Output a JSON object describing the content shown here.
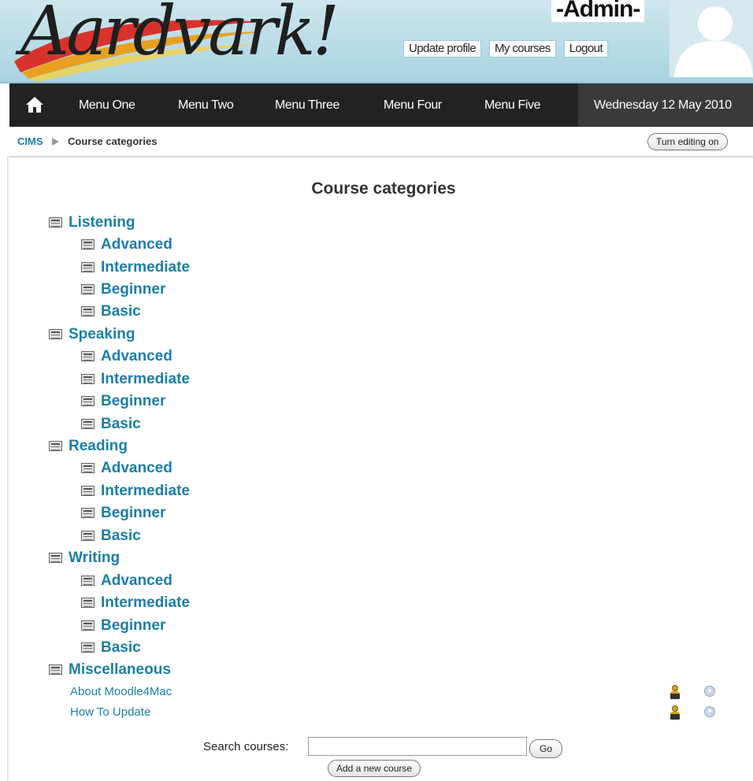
{
  "header": {
    "logo_text": "Aardvark!",
    "admin_label": "-Admin-",
    "links": [
      "Update profile",
      "My courses",
      "Logout"
    ]
  },
  "nav": {
    "home_icon": "home-icon",
    "items": [
      "Menu One",
      "Menu Two",
      "Menu Three",
      "Menu Four",
      "Menu Five"
    ],
    "date": "Wednesday 12 May 2010"
  },
  "breadcrumb": {
    "home": "CIMS",
    "current": "Course categories",
    "edit_button": "Turn editing on"
  },
  "main": {
    "title": "Course categories",
    "categories": [
      {
        "name": "Listening",
        "subs": [
          "Advanced",
          "Intermediate",
          "Beginner",
          "Basic"
        ]
      },
      {
        "name": "Speaking",
        "subs": [
          "Advanced",
          "Intermediate",
          "Beginner",
          "Basic"
        ]
      },
      {
        "name": "Reading",
        "subs": [
          "Advanced",
          "Intermediate",
          "Beginner",
          "Basic"
        ]
      },
      {
        "name": "Writing",
        "subs": [
          "Advanced",
          "Intermediate",
          "Beginner",
          "Basic"
        ]
      },
      {
        "name": "Miscellaneous",
        "subs": []
      }
    ],
    "courses": [
      "About Moodle4Mac",
      "How To Update"
    ],
    "search_label": "Search courses:",
    "search_value": "",
    "go_button": "Go",
    "add_button": "Add a new course"
  },
  "colors": {
    "link": "#1b7fa6",
    "header_bg": "#a9d3e1",
    "navbar_bg": "#222222"
  }
}
